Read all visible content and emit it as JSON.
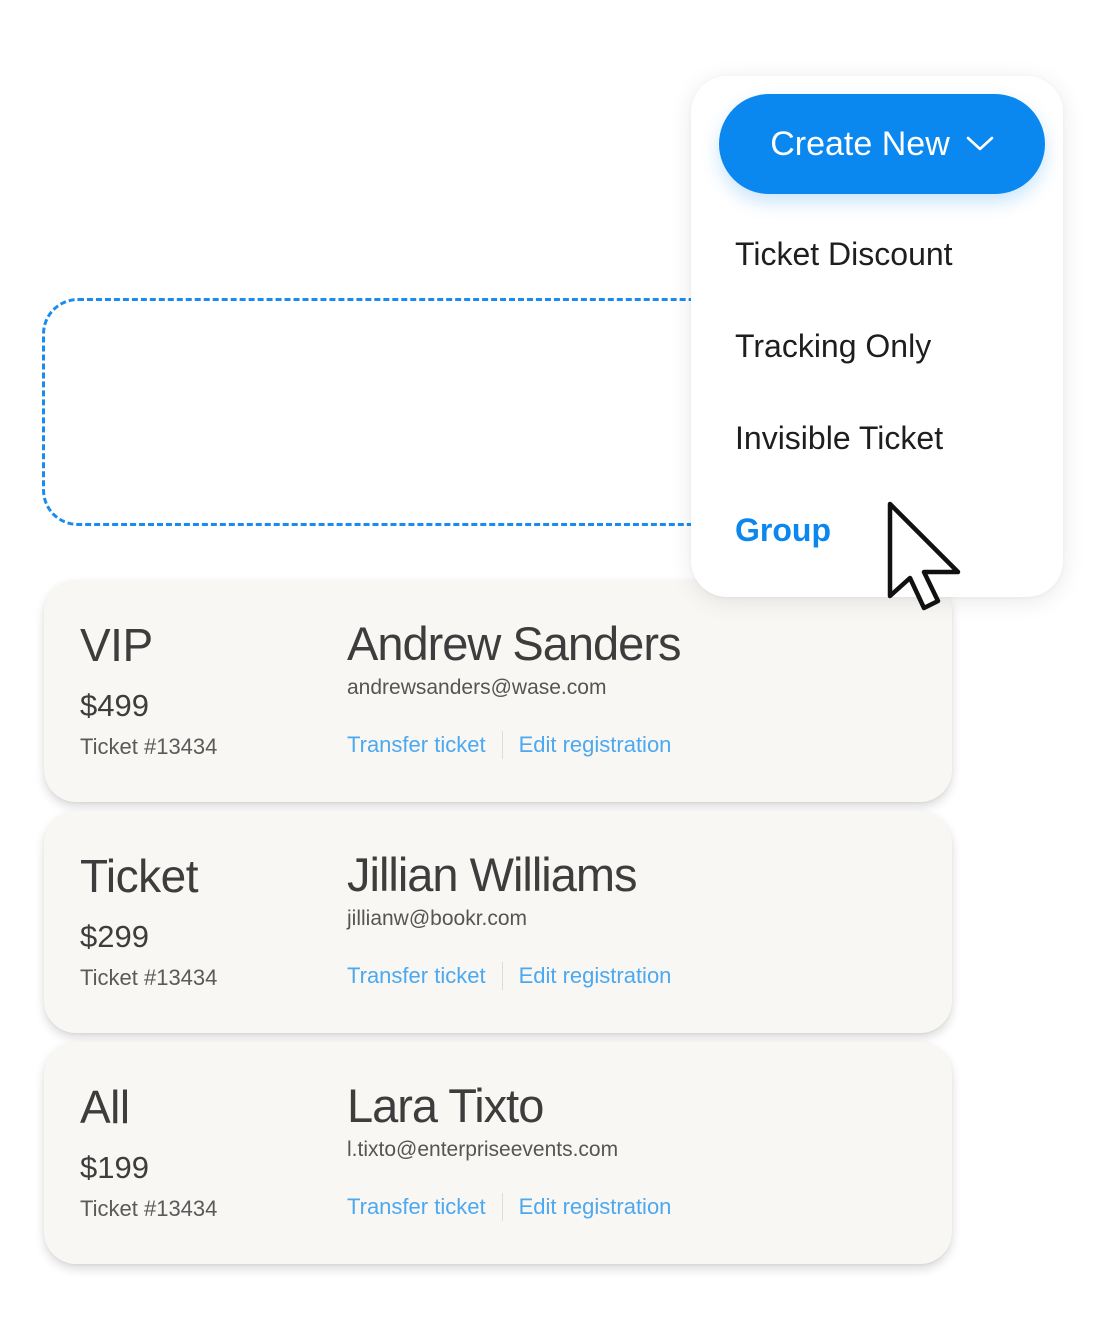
{
  "dropdown": {
    "button_label": "Create New",
    "items": [
      {
        "label": "Ticket Discount",
        "active": false
      },
      {
        "label": "Tracking Only",
        "active": false
      },
      {
        "label": "Invisible Ticket",
        "active": false
      },
      {
        "label": "Group",
        "active": true
      }
    ]
  },
  "tickets": [
    {
      "type": "VIP",
      "price": "$499",
      "ticket_number": "Ticket #13434",
      "name": "Andrew Sanders",
      "email": "andrewsanders@wase.com",
      "transfer_label": "Transfer ticket",
      "edit_label": "Edit registration"
    },
    {
      "type": "Ticket",
      "price": "$299",
      "ticket_number": "Ticket #13434",
      "name": "Jillian Williams",
      "email": "jillianw@bookr.com",
      "transfer_label": "Transfer ticket",
      "edit_label": "Edit registration"
    },
    {
      "type": "All",
      "price": "$199",
      "ticket_number": "Ticket #13434",
      "name": "Lara Tixto",
      "email": "l.tixto@enterpriseevents.com",
      "transfer_label": "Transfer ticket",
      "edit_label": "Edit registration"
    }
  ],
  "icons": {
    "dropdown_chevron": "chevron-down-icon",
    "pointer": "mouse-pointer-icon"
  },
  "colors": {
    "accent": "#0b87f0",
    "link": "#4ca8ef",
    "dashed_border": "#1a8cf0",
    "card_background": "#f8f7f4"
  }
}
